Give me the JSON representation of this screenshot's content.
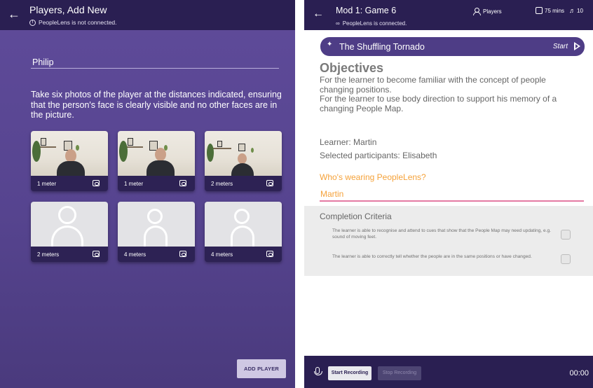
{
  "left": {
    "title": "Players, Add New",
    "status": "PeopleLens is not connected.",
    "name_value": "Philip",
    "instructions": "Take six photos of the player at the distances indicated, ensuring that the person's face is clearly visible and no other faces are in the picture.",
    "photos": [
      {
        "label": "1 meter",
        "state": "taken"
      },
      {
        "label": "1 meter",
        "state": "taken"
      },
      {
        "label": "2 meters",
        "state": "taken"
      },
      {
        "label": "2 meters",
        "state": "empty"
      },
      {
        "label": "4 meters",
        "state": "empty"
      },
      {
        "label": "4 meters",
        "state": "empty"
      }
    ],
    "add_player_label": "ADD PLAYER"
  },
  "right": {
    "title": "Mod 1: Game 6",
    "status": "PeopleLens is connected.",
    "players_label": "Players",
    "duration_label": "75 mins",
    "volume_label": "10",
    "game_name": "The Shuffling Tornado",
    "start_label": "Start",
    "objectives_heading": "Objectives",
    "objectives_text": "For the learner to become familiar with the concept of people changing positions.\nFor the learner to use body direction to support his memory of a changing People Map.",
    "learner_text": "Learner: Martin",
    "participants_text": "Selected participants: Elisabeth",
    "wearing_question": "Who's wearing PeopleLens?",
    "wearing_value": "Martin",
    "criteria_heading": "Completion Criteria",
    "criteria": [
      {
        "text": "The learner is able to recognise and attend to cues that show that the People Map may need updating, e.g. sound of moving feet."
      },
      {
        "text": "The learner is able to correctly tell whether the people are in the same positions or have changed."
      }
    ],
    "start_recording_label": "Start Recording",
    "stop_recording_label": "Stop Recording",
    "recording_time": "00:00"
  },
  "colors": {
    "topbar": "#2a1f52",
    "left_bg": "#5a479a",
    "pill": "#4e3d86",
    "accent_orange": "#f5a23a",
    "accent_pink": "#e47aa3"
  }
}
